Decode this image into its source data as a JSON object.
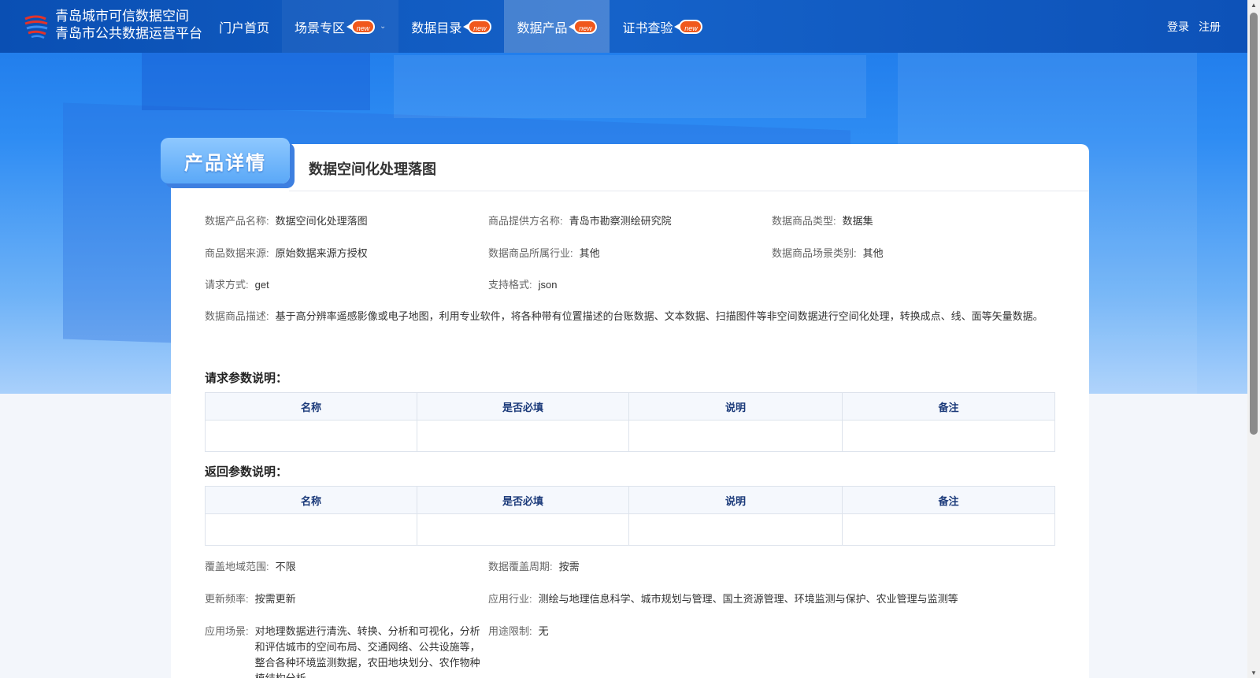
{
  "brand": {
    "line1": "青岛城市可信数据空间",
    "line2": "青岛市公共数据运营平台"
  },
  "nav": [
    {
      "label": "门户首页",
      "badge": ""
    },
    {
      "label": "场景专区",
      "badge": "new"
    },
    {
      "label": "数据目录",
      "badge": "new"
    },
    {
      "label": "数据产品",
      "badge": "new"
    },
    {
      "label": "证书查验",
      "badge": "new"
    }
  ],
  "auth": {
    "login": "登录",
    "register": "注册"
  },
  "detail_tag": "产品详情",
  "product_title": "数据空间化处理落图",
  "fields": {
    "name": {
      "label": "数据产品名称:",
      "value": "数据空间化处理落图"
    },
    "provider": {
      "label": "商品提供方名称:",
      "value": "青岛市勘察测绘研究院"
    },
    "type": {
      "label": "数据商品类型:",
      "value": "数据集"
    },
    "source": {
      "label": "商品数据来源:",
      "value": "原始数据来源方授权"
    },
    "industry": {
      "label": "数据商品所属行业:",
      "value": "其他"
    },
    "scene_type": {
      "label": "数据商品场景类别:",
      "value": "其他"
    },
    "method": {
      "label": "请求方式:",
      "value": "get"
    },
    "format": {
      "label": "支持格式:",
      "value": "json"
    },
    "desc": {
      "label": "数据商品描述:",
      "value": "基于高分辨率遥感影像或电子地图，利用专业软件，将各种带有位置描述的台账数据、文本数据、扫描图件等非空间数据进行空间化处理，转换成点、线、面等矢量数据。"
    },
    "region": {
      "label": "覆盖地域范围:",
      "value": "不限"
    },
    "period": {
      "label": "数据覆盖周期:",
      "value": "按需"
    },
    "freq": {
      "label": "更新频率:",
      "value": "按需更新"
    },
    "app_industry": {
      "label": "应用行业:",
      "value": "测绘与地理信息科学、城市规划与管理、国土资源管理、环境监测与保护、农业管理与监测等"
    },
    "app_scene": {
      "label": "应用场景:",
      "value": "对地理数据进行清洗、转换、分析和可视化，分析和评估城市的空间布局、交通网络、公共设施等，整合各种环境监测数据，农田地块划分、农作物种植结构分析"
    },
    "limit": {
      "label": "用途限制:",
      "value": "无"
    }
  },
  "request_params": {
    "title": "请求参数说明：",
    "headers": [
      "名称",
      "是否必填",
      "说明",
      "备注"
    ]
  },
  "response_params": {
    "title": "返回参数说明：",
    "headers": [
      "名称",
      "是否必填",
      "说明",
      "备注"
    ]
  },
  "colors": {
    "primary": "#0d52b8",
    "hero": "#2e8cf3",
    "badge": "#f0581c"
  }
}
